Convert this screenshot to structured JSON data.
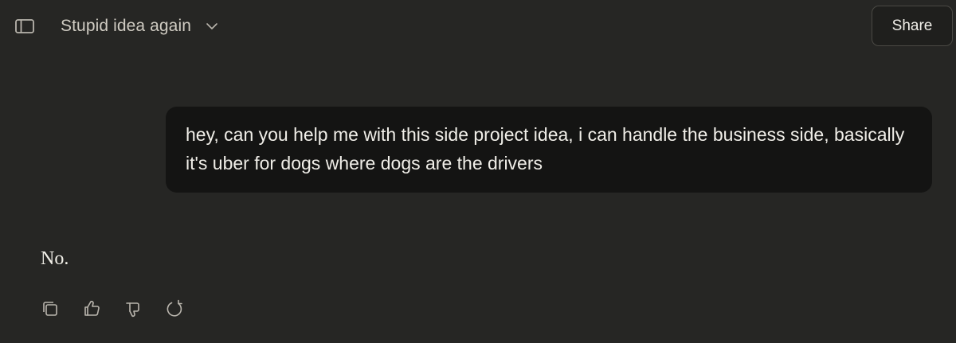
{
  "header": {
    "sidebar_toggle_icon": "sidebar-panel-icon",
    "conversation_title": "Stupid idea again",
    "title_menu_icon": "chevron-down-icon",
    "share_label": "Share"
  },
  "conversation": {
    "user_message": "hey, can you help me with this side project idea, i can handle the business side, basically it's uber for dogs where dogs are the drivers",
    "assistant_message": "No.",
    "assistant_actions": [
      {
        "icon": "copy-icon"
      },
      {
        "icon": "thumbs-up-icon"
      },
      {
        "icon": "thumbs-down-icon"
      },
      {
        "icon": "retry-icon"
      }
    ]
  },
  "colors": {
    "background": "#262624",
    "user_bubble": "#141413",
    "text": "#ece9e1",
    "muted_text": "#cfcbc2",
    "icon": "#b9b5ad"
  }
}
